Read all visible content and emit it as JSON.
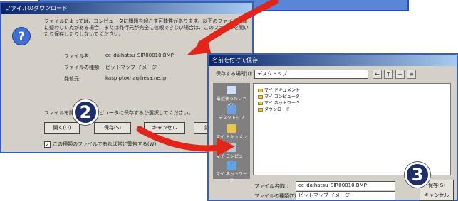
{
  "download_dialog": {
    "title": "ファイルのダウンロード",
    "message": "ファイルによっては、コンピュータに問題を起こす可能性があります。以下のファイル情報に疑わしい点がある場合、または発行元が完全に信頼できない場合は、このファイルを開いたり保存したりしないでください。",
    "file_name_label": "ファイル名:",
    "file_name_value": "cc_daihatsu_SIR00010.BMP",
    "file_type_label": "ファイルの種類:",
    "file_type_value": "ビットマップ イメージ",
    "source_label": "発信元:",
    "source_value": "kasp.ptoxhaqihesa.ne.jp",
    "prompt": "ファイルを開くか、コンピュータに保存するか選択してください。",
    "open_button": "開く(O)",
    "save_button": "保存(S)",
    "cancel_button": "キャンセル",
    "details_button": "詳細情報",
    "always_ask_label": "この種類のファイルであれば常に警告する(W)"
  },
  "save_dialog": {
    "title": "名前を付けて保存",
    "save_in_label": "保存する場所(I):",
    "save_in_value": "デスクトップ",
    "places": [
      "最近使ったファイル",
      "デスクトップ",
      "マイ ドキュメント",
      "マイ コンピュータ",
      "マイ ネットワーク"
    ],
    "files": [
      "マイ ドキュメント",
      "マイ コンピュータ",
      "マイ ネットワーク",
      "ダウンロード"
    ],
    "file_name_label": "ファイル名(N):",
    "file_name_value": "cc_daihatsu_SIR00010.BMP",
    "file_type_label": "ファイルの種類(T):",
    "file_type_value": "ビットマップ イメージ",
    "save_button": "保存(S)",
    "cancel_button": "キャンセル"
  },
  "steps": {
    "step2": "2",
    "step3": "3"
  },
  "colors": {
    "arrow": "#e32418",
    "badge": "#1e2f6a",
    "frame": "#3a5fb0"
  }
}
